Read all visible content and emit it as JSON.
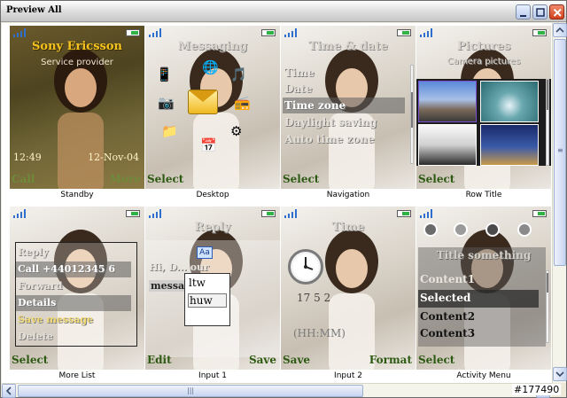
{
  "window": {
    "title": "Preview All"
  },
  "colors": {
    "softkey": "#2d5a12",
    "operator": "#f4c21e",
    "battery": "#2fb344"
  },
  "cells": {
    "standby": {
      "caption": "Standby",
      "operator": "Sony Ericsson",
      "provider": "Service provider",
      "time": "12:49",
      "date": "12-Nov-04",
      "left_key": "Call",
      "right_key": "More"
    },
    "desktop": {
      "caption": "Desktop",
      "header": "Messaging",
      "left_key": "Select"
    },
    "navigation": {
      "caption": "Navigation",
      "header": "Time & date",
      "items": [
        "Time",
        "Date",
        "Time zone",
        "Daylight saving",
        "Auto time zone"
      ],
      "left_key": "Select"
    },
    "row_title": {
      "caption": "Row Title",
      "header": "Pictures",
      "subheader": "Camera pictures",
      "left_key": "Select"
    },
    "more_list": {
      "caption": "More List",
      "items": [
        "Reply",
        "Call +44012345 6",
        "Forward",
        "Details",
        "Save message",
        "Delete"
      ],
      "left_key": "Select"
    },
    "input1": {
      "caption": "Input 1",
      "header": "Reply",
      "badge": "Aa",
      "line": "Hi, D... our",
      "message": "messa",
      "options": [
        "ltw",
        "huw"
      ],
      "left_key": "Edit",
      "right_key": "Save"
    },
    "input2": {
      "caption": "Input 2",
      "header": "Time",
      "time_value": "17 5 2",
      "time_format": "(HH:MM)",
      "left_key": "Save",
      "right_key": "Format"
    },
    "activity": {
      "caption": "Activity Menu",
      "title": "Title something",
      "items": [
        "Content1",
        "Selected",
        "Content2",
        "Content3"
      ],
      "left_key": "Select"
    }
  },
  "watermark": "#177490"
}
